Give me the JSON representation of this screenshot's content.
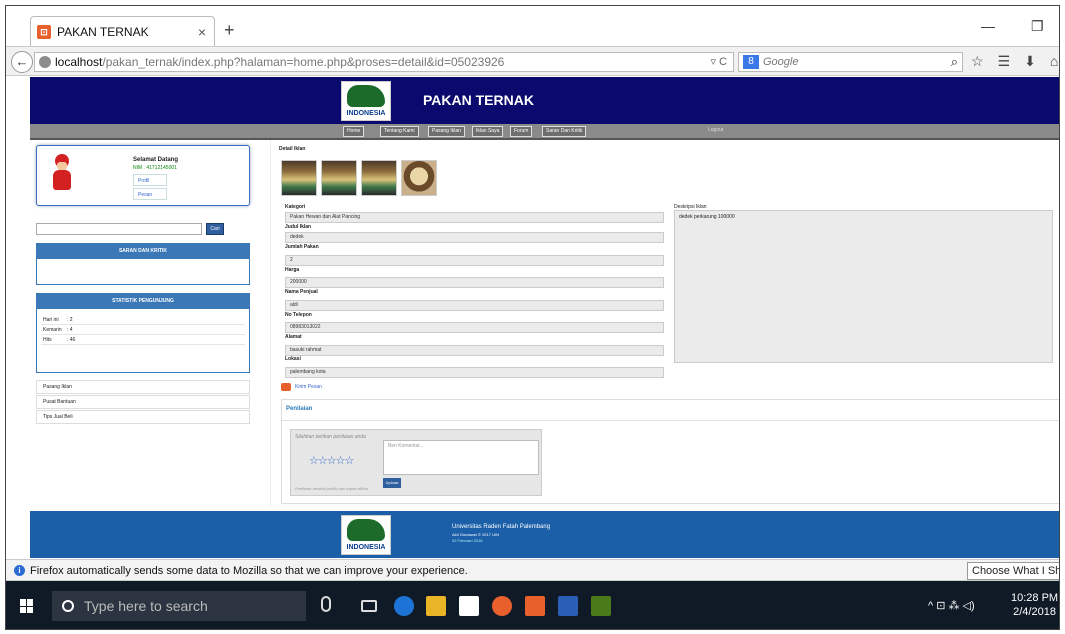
{
  "browser": {
    "tab_title": "PAKAN TERNAK",
    "tab_close": "×",
    "new_tab": "+",
    "win_min": "—",
    "win_max": "❐",
    "back": "←",
    "url_host": "localhost",
    "url_path": "/pakan_ternak/index.php?halaman=home.php&proses=detail&id=05023926",
    "url_right": "▿ C",
    "search_engine": "8",
    "search_placeholder": "Google",
    "search_icon": "⌕",
    "nav_icons": [
      "☆",
      "☰",
      "⬇",
      "⌂"
    ]
  },
  "site": {
    "logo_text": "INDONESIA",
    "title": "PAKAN TERNAK",
    "menu": [
      "Home",
      "Tentang Kami",
      "Pasang Iklan",
      "Iklan Saya",
      "Forum",
      "Saran Dan Kritik"
    ],
    "logout": "Logout"
  },
  "sidebar": {
    "greeting": "Selamat Datang",
    "nim": "NIM : 41712145001",
    "links": [
      "Profil",
      "Pesan"
    ],
    "search_button": "Cari",
    "saran_title": "SARAN DAN KRITIK",
    "stat_title": "STATISTIK PENGUNJUNG",
    "stats": [
      {
        "label": "Hari ini",
        "value": ": 2"
      },
      {
        "label": "Kemarin",
        "value": ": 4"
      },
      {
        "label": "Hits",
        "value": ": 46"
      }
    ],
    "menu": [
      "Pasang Iklan",
      "Pusat Bantuan",
      "Tips Jual Beli"
    ]
  },
  "detail": {
    "heading": "Detail Iklan",
    "fields": [
      {
        "label": "Kategori",
        "value": "Pakan Hewan dan Alat Pancing"
      },
      {
        "label": "Judul Iklan",
        "value": "dedek"
      },
      {
        "label": "Jumlah Pakan",
        "value": "2"
      },
      {
        "label": "Harga",
        "value": "200000"
      },
      {
        "label": "Nama Penjual",
        "value": "aldi"
      },
      {
        "label": "No Telepon",
        "value": "08983013022"
      },
      {
        "label": "Alamat",
        "value": "basuki rahmat"
      },
      {
        "label": "Lokasi",
        "value": "palembang kota"
      }
    ],
    "desc_label": "Deskripsi Iklan",
    "desc_value": "dedek perkarung 100000",
    "send_message": "Kirim Pesan"
  },
  "rating": {
    "title": "Penilaian",
    "hint": "Silahkan berikan penilaian anda",
    "stars": "☆☆☆☆☆",
    "comment_placeholder": "Beri Komentar...",
    "submit": "Upload",
    "footnote": "Penilaian bersifat publik dan dapat dilihat"
  },
  "footer": {
    "line1": "Universitas Raden Fatah Palembang",
    "line2": "Aldi Gunawan © 2017 UIN",
    "line3": "02 Februari 2018"
  },
  "notification": {
    "icon": "i",
    "text": "Firefox automatically sends some data to Mozilla so that we can improve your experience.",
    "button": "Choose What I Share"
  },
  "taskbar": {
    "search_placeholder": "Type here to search",
    "tray": "^ ⊡ ⁂ ◁)",
    "time": "10:28 PM",
    "date": "2/4/2018"
  }
}
